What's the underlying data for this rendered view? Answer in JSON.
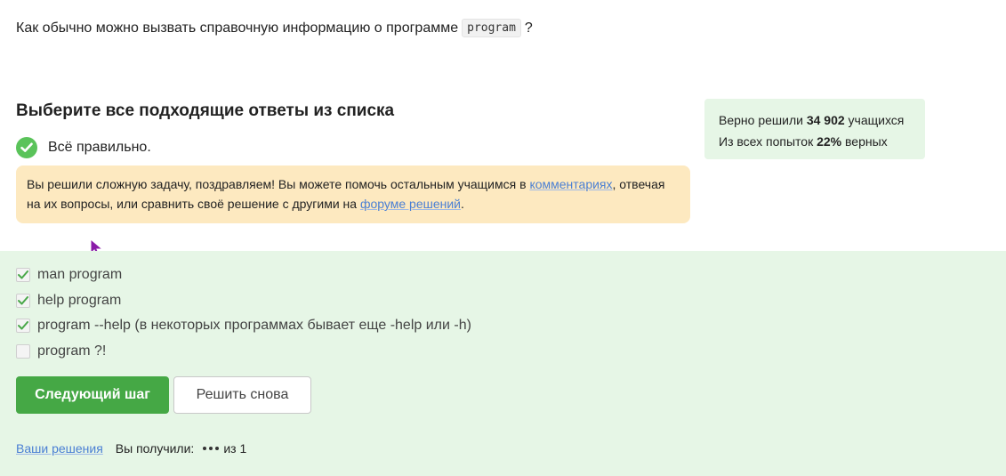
{
  "question": {
    "text_before": "Как обычно можно вызвать справочную информацию о программе",
    "code": "program",
    "text_after": "?"
  },
  "section_title": "Выберите все подходящие ответы из списка",
  "stats": {
    "line1_before": "Верно решили",
    "line1_value": "34 902",
    "line1_after": "учащихся",
    "line2_before": "Из всех попыток",
    "line2_value": "22%",
    "line2_after": "верных"
  },
  "result": {
    "text": "Всё правильно."
  },
  "notice": {
    "part1": "Вы решили сложную задачу, поздравляем! Вы можете помочь остальным учащимся в ",
    "link1": "комментариях",
    "part2": ", отвечая на их вопросы, или сравнить своё решение с другими на ",
    "link2": "форуме решений",
    "part3": "."
  },
  "options": [
    {
      "label": "man program",
      "checked": true
    },
    {
      "label": "help program",
      "checked": true
    },
    {
      "label": "program --help (в некоторых программах бывает еще -help или -h)",
      "checked": true
    },
    {
      "label": "program ?!",
      "checked": false
    }
  ],
  "buttons": {
    "next": "Следующий шаг",
    "retry": "Решить снова"
  },
  "footer": {
    "solutions_link": "Ваши решения",
    "score_label": "Вы получили:",
    "score_suffix": "из 1"
  },
  "colors": {
    "accent_green": "#45a845",
    "success_bg": "#e6f6e6",
    "notice_bg": "#fde9c0",
    "link": "#4a7fd4"
  }
}
